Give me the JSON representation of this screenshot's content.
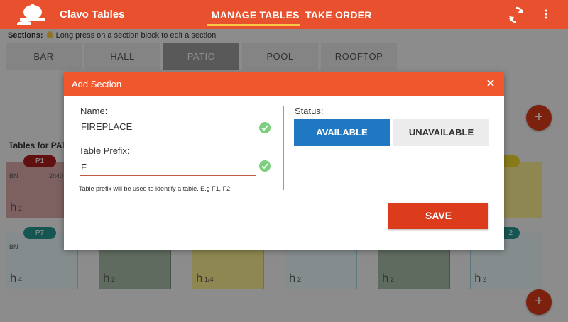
{
  "app": {
    "title": "Clavo Tables",
    "brand_color": "#e8502e"
  },
  "nav": {
    "tabs": [
      {
        "label": "MANAGE TABLES",
        "active": true
      },
      {
        "label": "TAKE ORDER",
        "active": false
      }
    ],
    "icons": [
      "sync-icon",
      "overflow-menu-icon"
    ]
  },
  "sections": {
    "label": "Sections:",
    "hint": "Long press on a section block to edit a section",
    "tabs": [
      {
        "label": "BAR",
        "active": false
      },
      {
        "label": "HALL",
        "active": false
      },
      {
        "label": "PATIO",
        "active": true
      },
      {
        "label": "POOL",
        "active": false
      },
      {
        "label": "ROOFTOP",
        "active": false
      }
    ]
  },
  "tables": {
    "label": "Tables for PAT",
    "cards": [
      {
        "name": "P1",
        "label": "BN",
        "timer": "2h40",
        "seats": "2",
        "status": "occupied"
      },
      {
        "name": "",
        "label": "",
        "timer": "",
        "seats": "",
        "status": "reserved"
      },
      {
        "name": "P7",
        "label": "BN",
        "timer": "",
        "seats": "4",
        "status": "free"
      },
      {
        "name": "",
        "label": "",
        "timer": "",
        "seats": "2",
        "status": "unavailable"
      },
      {
        "name": "",
        "label": "",
        "timer": "",
        "seats": "1/4",
        "status": "reserved"
      },
      {
        "name": "",
        "label": "",
        "timer": "",
        "seats": "2",
        "status": "free"
      },
      {
        "name": "",
        "label": "",
        "timer": "",
        "seats": "2",
        "status": "unavailable"
      },
      {
        "name": "",
        "label": "",
        "timer": "",
        "seats": "2",
        "status": "free"
      }
    ],
    "partial_badge": "2",
    "fab_label": "+"
  },
  "dialog": {
    "title": "Add Section",
    "name_label": "Name:",
    "name_value": "FIREPLACE",
    "prefix_label": "Table Prefix:",
    "prefix_value": "F",
    "prefix_hint": "Table prefix will be used to identify a table. E.g F1, F2.",
    "status_label": "Status:",
    "status_options": [
      "AVAILABLE",
      "UNAVAILABLE"
    ],
    "status_selected": "AVAILABLE",
    "save_label": "SAVE"
  },
  "colors": {
    "header": "#f0572d",
    "available": "#1f78c1",
    "save": "#dc3b1c",
    "valid_check": "#7ccf7c"
  }
}
